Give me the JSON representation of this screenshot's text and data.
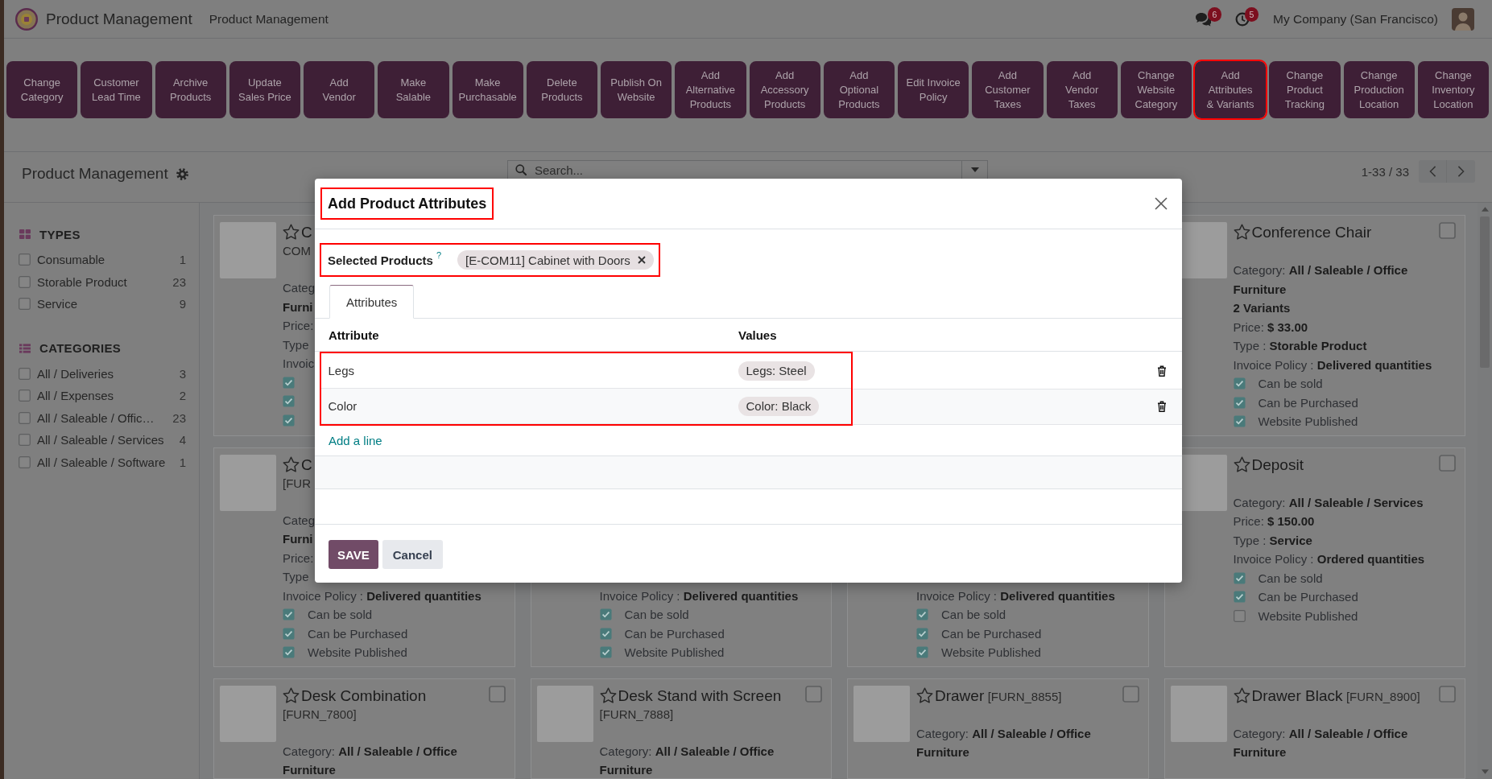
{
  "navbar": {
    "app_name": "Product Management",
    "menu_items": [
      "Product Management"
    ],
    "messages_count": "6",
    "activities_count": "5",
    "company": "My Company (San Francisco)"
  },
  "action_buttons": [
    {
      "label": "Change\nCategory",
      "highlighted": false
    },
    {
      "label": "Customer\nLead Time",
      "highlighted": false
    },
    {
      "label": "Archive\nProducts",
      "highlighted": false
    },
    {
      "label": "Update\nSales Price",
      "highlighted": false
    },
    {
      "label": "Add\nVendor",
      "highlighted": false
    },
    {
      "label": "Make\nSalable",
      "highlighted": false
    },
    {
      "label": "Make\nPurchasable",
      "highlighted": false
    },
    {
      "label": "Delete\nProducts",
      "highlighted": false
    },
    {
      "label": "Publish On\nWebsite",
      "highlighted": false
    },
    {
      "label": "Add\nAlternative\nProducts",
      "highlighted": false
    },
    {
      "label": "Add\nAccessory\nProducts",
      "highlighted": false
    },
    {
      "label": "Add\nOptional\nProducts",
      "highlighted": false
    },
    {
      "label": "Edit Invoice\nPolicy",
      "highlighted": false
    },
    {
      "label": "Add\nCustomer\nTaxes",
      "highlighted": false
    },
    {
      "label": "Add\nVendor\nTaxes",
      "highlighted": false
    },
    {
      "label": "Change\nWebsite\nCategory",
      "highlighted": false
    },
    {
      "label": "Add\nAttributes\n& Variants",
      "highlighted": true
    },
    {
      "label": "Change\nProduct\nTracking",
      "highlighted": false
    },
    {
      "label": "Change\nProduction\nLocation",
      "highlighted": false
    },
    {
      "label": "Change\nInventory\nLocation",
      "highlighted": false
    }
  ],
  "control_panel": {
    "title": "Product Management",
    "search": {
      "placeholder": "Search..."
    },
    "pager": "1-33 / 33"
  },
  "sidebar": {
    "sections": [
      {
        "title": "TYPES",
        "items": [
          {
            "label": "Consumable",
            "count": "1",
            "checked": false
          },
          {
            "label": "Storable Product",
            "count": "23",
            "checked": false
          },
          {
            "label": "Service",
            "count": "9",
            "checked": false
          }
        ]
      },
      {
        "title": "CATEGORIES",
        "items": [
          {
            "label": "All / Deliveries",
            "count": "3",
            "checked": false
          },
          {
            "label": "All / Expenses",
            "count": "2",
            "checked": false
          },
          {
            "label": "All / Saleable / Offic…",
            "count": "23",
            "checked": false
          },
          {
            "label": "All / Saleable / Services",
            "count": "4",
            "checked": false
          },
          {
            "label": "All / Saleable / Software",
            "count": "1",
            "checked": false
          }
        ]
      }
    ]
  },
  "kanban": {
    "rows": [
      {
        "cards": [
          {
            "title": "C",
            "reference": "COM",
            "favorite": false,
            "lines": [
              {
                "kind": "field",
                "text": "Categ **Furni**"
              },
              {
                "kind": "field",
                "text": "Price:"
              },
              {
                "kind": "field",
                "text": "Type"
              },
              {
                "kind": "field",
                "text": "Invoic"
              }
            ],
            "flags": [
              {
                "checked": true
              },
              {
                "checked": true
              },
              {
                "checked": true
              }
            ]
          },
          {
            "title": "Conference Chair",
            "favorite": false,
            "selected": false,
            "lines": [
              {
                "kind": "field",
                "text": "Category: **All / Saleable / Office Furniture**"
              },
              {
                "kind": "emphasis",
                "text": "2 Variants"
              },
              {
                "kind": "field",
                "text": "Price: **$ 33.00**"
              },
              {
                "kind": "field",
                "text": "Type : **Storable Product**"
              },
              {
                "kind": "field",
                "text": "Invoice Policy : **Delivered quantities**"
              }
            ],
            "flags": [
              {
                "label": "Can be sold",
                "checked": true
              },
              {
                "label": "Can be Purchased",
                "checked": true
              },
              {
                "label": "Website Published",
                "checked": true
              }
            ]
          }
        ]
      },
      {
        "cards": [
          {
            "title": "C",
            "reference": "[FUR",
            "favorite": false,
            "lines": [
              {
                "kind": "field",
                "text": "Categ **Furni**"
              },
              {
                "kind": "field",
                "text": "Price:"
              },
              {
                "kind": "field",
                "text": "Type"
              },
              {
                "kind": "field",
                "text": "Invoice Policy : **Delivered quantities**"
              }
            ],
            "flags": [
              {
                "label": "Can be sold",
                "checked": true
              },
              {
                "label": "Can be Purchased",
                "checked": true
              },
              {
                "label": "Website Published",
                "checked": true
              }
            ]
          },
          {
            "lines": [
              {
                "kind": "field",
                "text": "Invoice Policy : **Delivered quantities**"
              }
            ],
            "flags": [
              {
                "label": "Can be sold",
                "checked": true
              },
              {
                "label": "Can be Purchased",
                "checked": true
              },
              {
                "label": "Website Published",
                "checked": true
              }
            ]
          },
          {
            "lines": [
              {
                "kind": "field",
                "text": "Invoice Policy : **Delivered quantities**"
              }
            ],
            "flags": [
              {
                "label": "Can be sold",
                "checked": true
              },
              {
                "label": "Can be Purchased",
                "checked": true
              },
              {
                "label": "Website Published",
                "checked": true
              }
            ]
          },
          {
            "title": "Deposit",
            "favorite": false,
            "selected": false,
            "lines": [
              {
                "kind": "field",
                "text": "Category: **All / Saleable / Services**"
              },
              {
                "kind": "field",
                "text": "Price: **$ 150.00**"
              },
              {
                "kind": "field",
                "text": "Type : **Service**"
              },
              {
                "kind": "field",
                "text": "Invoice Policy : **Ordered quantities**"
              }
            ],
            "flags": [
              {
                "label": "Can be sold",
                "checked": true
              },
              {
                "label": "Can be Purchased",
                "checked": true
              },
              {
                "label": "Website Published",
                "checked": false
              }
            ]
          }
        ]
      },
      {
        "cards": [
          {
            "title": "Desk Combination",
            "reference": "[FURN_7800]",
            "favorite": false,
            "selected": false,
            "lines": [
              {
                "kind": "field",
                "text": "Category: **All / Saleable / Office Furniture**"
              }
            ]
          },
          {
            "title": "Desk Stand with Screen",
            "reference": "[FURN_7888]",
            "favorite": false,
            "selected": false,
            "lines": [
              {
                "kind": "field",
                "text": "Category: **All / Saleable / Office Furniture**"
              }
            ]
          },
          {
            "title": "Drawer",
            "reference": "[FURN_8855]",
            "favorite": false,
            "selected": false,
            "lines": [
              {
                "kind": "field",
                "text": "Category: **All / Saleable / Office Furniture**"
              }
            ]
          },
          {
            "title": "Drawer Black",
            "reference": "[FURN_8900]",
            "favorite": false,
            "selected": false,
            "lines": [
              {
                "kind": "field",
                "text": "Category: **All / Saleable / Office Furniture**"
              }
            ]
          }
        ]
      }
    ]
  },
  "dialog": {
    "title": {
      "text": "Add Product Attributes",
      "highlighted": true
    },
    "selected_products": {
      "label": "Selected Products",
      "help": "?",
      "tags": [
        "[E-COM11] Cabinet with Doors"
      ],
      "highlighted": true
    },
    "tabs": [
      {
        "label": "Attributes",
        "selected": true
      }
    ],
    "table": {
      "columns": [
        "Attribute",
        "Values"
      ],
      "rows": [
        {
          "attribute": "Legs",
          "values": [
            "Legs: Steel"
          ]
        },
        {
          "attribute": "Color",
          "values": [
            "Color: Black"
          ]
        }
      ],
      "rows_highlighted": true,
      "add_line": "Add a line"
    },
    "buttons": [
      {
        "label": "SAVE",
        "kind": "primary"
      },
      {
        "label": "Cancel",
        "kind": "secondary"
      }
    ]
  }
}
